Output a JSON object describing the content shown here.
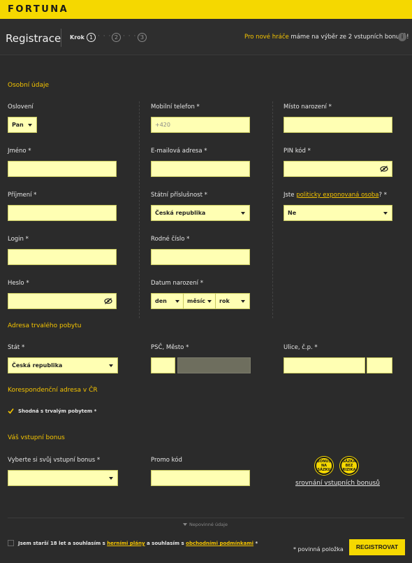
{
  "brand": {
    "logo": "FORTUNA"
  },
  "header": {
    "title": "Registrace",
    "steps_label": "Krok",
    "steps": [
      "1",
      "2",
      "3"
    ],
    "promo_highlight": "Pro nové hráče",
    "promo_text": " máme na výběr ze 2 vstupních bonusů!",
    "info_glyph": "i"
  },
  "sections": {
    "personal": "Osobní údaje",
    "address": "Adresa trvalého pobytu",
    "correspondence": "Korespondenční adresa v ČR",
    "bonus": "Váš vstupní bonus"
  },
  "labels": {
    "osloveni": "Oslovení",
    "mobil": "Mobilní telefon *",
    "misto": "Místo narození *",
    "jmeno": "Jméno *",
    "email": "E-mailová adresa *",
    "pin": "PIN kód *",
    "prijmeni": "Příjmení *",
    "statni": "Státní příslušnost *",
    "pep_pre": "Jste ",
    "pep_link": "politicky exponovaná osoba",
    "pep_post": "? *",
    "login": "Login *",
    "rodne": "Rodné číslo *",
    "heslo": "Heslo *",
    "datum": "Datum narození *",
    "stat": "Stát *",
    "psc": "PSČ, Město *",
    "ulice": "Ulice, č.p. *",
    "bonus_select": "Vyberte si svůj vstupní bonus *",
    "promo": "Promo kód"
  },
  "values": {
    "osloveni": "Pan",
    "mobil_prefix": "+420",
    "statni": "Česká republika",
    "pep": "Ne",
    "den": "den",
    "mesic": "měsíc",
    "rok": "rok",
    "stat": "Česká republika"
  },
  "correspondence_checkbox": "Shodná s trvalým pobytem *",
  "bonus_badges": {
    "badge1": "BONUS NA SÁZKU",
    "badge2": "SÁZKA BEZ RIZIKA"
  },
  "bonus_compare": "srovnání vstupních bonusů",
  "optional_toggle": "Nepovinné údaje",
  "consent": {
    "pre": "Jsem starší 18 let a souhlasím s ",
    "link1": "herními plány",
    "mid": " a souhlasím s ",
    "link2": "obchodními podmínkami",
    "post": " *"
  },
  "required_note": "* povinná položka",
  "submit": "REGISTROVAT",
  "colors": {
    "brand_yellow": "#f5d800",
    "accent": "#f5c400",
    "input_bg": "#ffffb3",
    "bg": "#2b2b2b"
  }
}
